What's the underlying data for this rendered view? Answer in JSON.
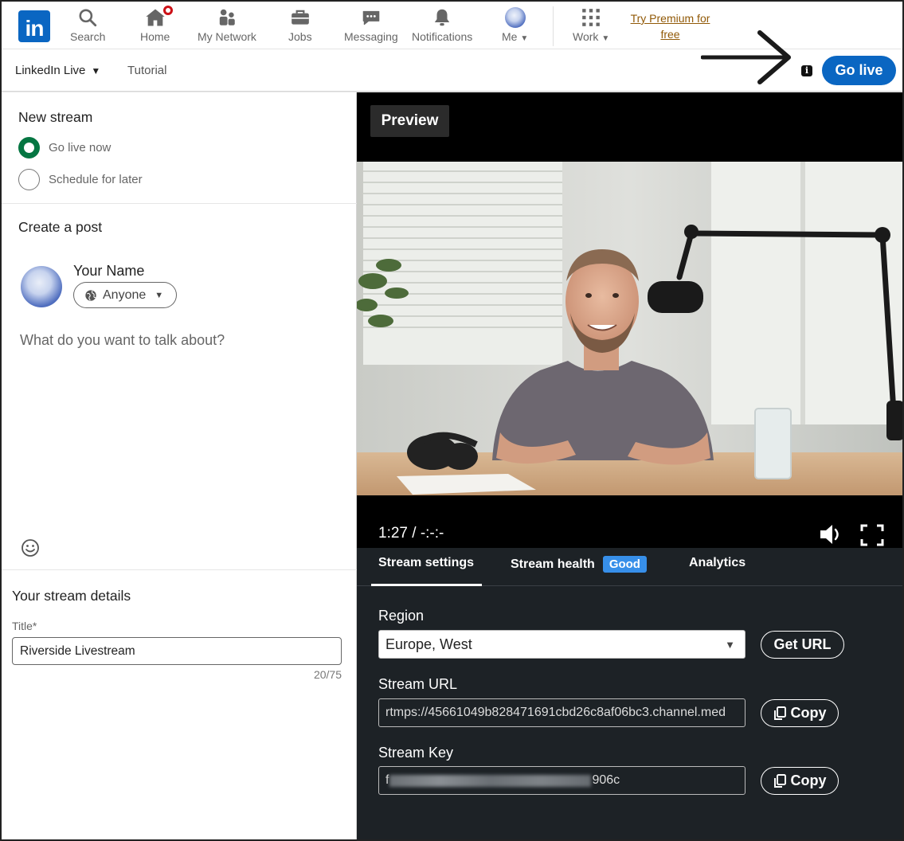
{
  "nav": {
    "logo": "in",
    "items": [
      {
        "label": "Search",
        "icon": "search-icon"
      },
      {
        "label": "Home",
        "icon": "home-icon"
      },
      {
        "label": "My Network",
        "icon": "network-icon"
      },
      {
        "label": "Jobs",
        "icon": "briefcase-icon"
      },
      {
        "label": "Messaging",
        "icon": "message-icon"
      },
      {
        "label": "Notifications",
        "icon": "bell-icon"
      },
      {
        "label": "Me",
        "icon": "avatar-icon"
      },
      {
        "label": "Work",
        "icon": "grid-icon"
      }
    ],
    "premium": "Try Premium for free",
    "premium_color": "#915907",
    "brand_color": "#0a66c2"
  },
  "subbar": {
    "live_label": "LinkedIn Live",
    "tutorial": "Tutorial",
    "info": "i",
    "go_live": "Go live"
  },
  "left": {
    "new_stream": "New stream",
    "option_now": "Go live now",
    "option_later": "Schedule for later",
    "selected_option": "Go live now",
    "create_post": "Create a post",
    "your_name": "Your Name",
    "audience": "Anyone",
    "post_placeholder": "What do you want to talk about?",
    "stream_details": "Your stream details",
    "title_label": "Title*",
    "title_value": "Riverside Livestream",
    "counter": "20/75"
  },
  "player": {
    "preview": "Preview",
    "time": "1:27 / -:-:-"
  },
  "tabs": {
    "settings": "Stream settings",
    "health": "Stream health",
    "health_status": "Good",
    "analytics": "Analytics",
    "active": "Stream settings"
  },
  "settings": {
    "region_label": "Region",
    "region_value": "Europe, West",
    "get_url": "Get URL",
    "url_label": "Stream URL",
    "url_value": "rtmps://45661049b828471691cbd26c8af06bc3.channel.me⁠d",
    "copy": "Copy",
    "key_label": "Stream Key",
    "key_prefix": "f",
    "key_suffix": "906c"
  }
}
